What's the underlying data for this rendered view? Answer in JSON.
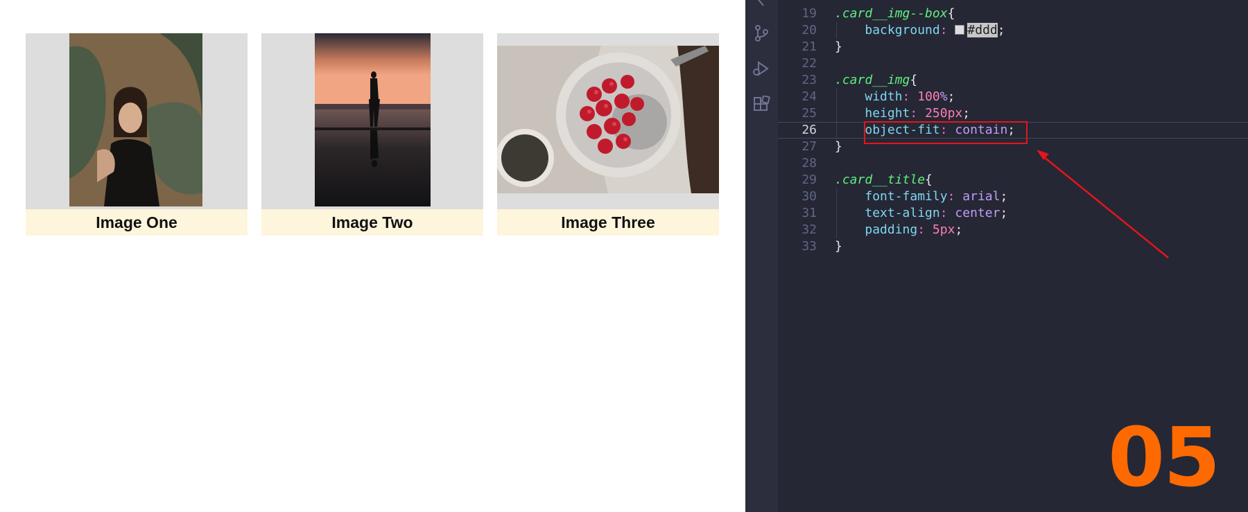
{
  "preview": {
    "cards": [
      {
        "title": "Image One",
        "photo": "woman-with-banana-leaves-photo"
      },
      {
        "title": "Image Two",
        "photo": "silhouette-at-sunset-pool-photo"
      },
      {
        "title": "Image Three",
        "photo": "bowl-of-raspberries-photo"
      }
    ]
  },
  "editor": {
    "lines": [
      {
        "n": "19",
        "tokens": [
          {
            "t": ".card__img--box",
            "c": "sel"
          },
          {
            "t": "{",
            "c": "punc"
          }
        ]
      },
      {
        "n": "20",
        "tokens": [
          {
            "t": "    ",
            "c": "punc"
          },
          {
            "t": "background",
            "c": "prop"
          },
          {
            "t": ": ",
            "c": "colon"
          },
          {
            "t": "",
            "c": "swatch"
          },
          {
            "t": "#ddd",
            "c": "hl"
          },
          {
            "t": ";",
            "c": "punc"
          }
        ]
      },
      {
        "n": "21",
        "tokens": [
          {
            "t": "}",
            "c": "punc"
          }
        ]
      },
      {
        "n": "22",
        "tokens": []
      },
      {
        "n": "23",
        "tokens": [
          {
            "t": ".card__img",
            "c": "sel"
          },
          {
            "t": "{",
            "c": "punc"
          }
        ]
      },
      {
        "n": "24",
        "tokens": [
          {
            "t": "    ",
            "c": "punc"
          },
          {
            "t": "width",
            "c": "prop"
          },
          {
            "t": ": ",
            "c": "colon"
          },
          {
            "t": "100",
            "c": "num"
          },
          {
            "t": "%",
            "c": "val"
          },
          {
            "t": ";",
            "c": "punc"
          }
        ]
      },
      {
        "n": "25",
        "tokens": [
          {
            "t": "    ",
            "c": "punc"
          },
          {
            "t": "height",
            "c": "prop"
          },
          {
            "t": ": ",
            "c": "colon"
          },
          {
            "t": "250",
            "c": "num"
          },
          {
            "t": "px",
            "c": "num"
          },
          {
            "t": ";",
            "c": "punc"
          }
        ]
      },
      {
        "n": "26",
        "current": true,
        "tokens": [
          {
            "t": "    ",
            "c": "punc"
          },
          {
            "t": "object-fit",
            "c": "prop"
          },
          {
            "t": ": ",
            "c": "colon"
          },
          {
            "t": "contain",
            "c": "val"
          },
          {
            "t": ";",
            "c": "punc"
          }
        ]
      },
      {
        "n": "27",
        "tokens": [
          {
            "t": "}",
            "c": "punc"
          }
        ]
      },
      {
        "n": "28",
        "tokens": []
      },
      {
        "n": "29",
        "tokens": [
          {
            "t": ".card__title",
            "c": "sel"
          },
          {
            "t": "{",
            "c": "punc"
          }
        ]
      },
      {
        "n": "30",
        "tokens": [
          {
            "t": "    ",
            "c": "punc"
          },
          {
            "t": "font-family",
            "c": "prop"
          },
          {
            "t": ": ",
            "c": "colon"
          },
          {
            "t": "arial",
            "c": "val"
          },
          {
            "t": ";",
            "c": "punc"
          }
        ]
      },
      {
        "n": "31",
        "tokens": [
          {
            "t": "    ",
            "c": "punc"
          },
          {
            "t": "text-align",
            "c": "prop"
          },
          {
            "t": ": ",
            "c": "colon"
          },
          {
            "t": "center",
            "c": "val"
          },
          {
            "t": ";",
            "c": "punc"
          }
        ]
      },
      {
        "n": "32",
        "tokens": [
          {
            "t": "    ",
            "c": "punc"
          },
          {
            "t": "padding",
            "c": "prop"
          },
          {
            "t": ": ",
            "c": "colon"
          },
          {
            "t": "5",
            "c": "num"
          },
          {
            "t": "px",
            "c": "num"
          },
          {
            "t": ";",
            "c": "punc"
          }
        ]
      },
      {
        "n": "33",
        "tokens": [
          {
            "t": "}",
            "c": "punc"
          }
        ]
      }
    ],
    "activity_icons": [
      "source-control-icon",
      "run-debug-icon",
      "extensions-icon"
    ]
  },
  "overlay": {
    "step_number": "05",
    "accent_color": "#ff6a00",
    "callout_color": "#e8141b"
  }
}
